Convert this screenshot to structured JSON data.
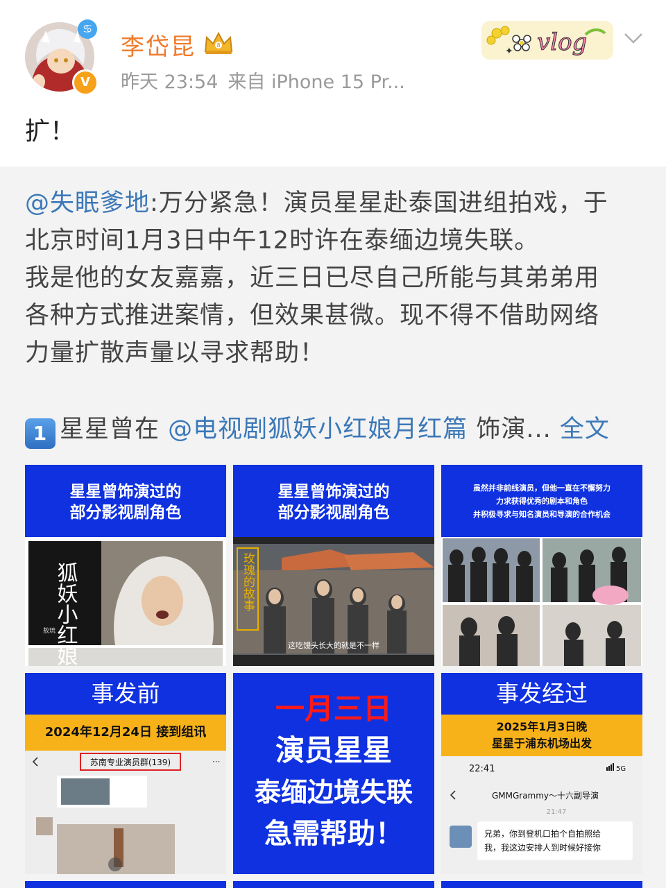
{
  "status_indicator_color": "#ff8a1f",
  "user": {
    "name": "李岱昆",
    "time": "昨天 23:54",
    "source": "来自 iPhone 15 Pr...",
    "verified_icon": "verified-badge-icon",
    "badge_icon": "crown-vip-icon"
  },
  "decor": {
    "vlog_label": "vlog"
  },
  "post": {
    "text": "扩！"
  },
  "repost": {
    "author": "@失眠爹地",
    "line1": ":万分紧急！演员星星赴泰国进组拍戏，于",
    "line2": "北京时间1月3日中午12时许在泰缅边境失联。",
    "line3": "我是他的女友嘉嘉，近三日已尽自己所能与其弟弟用",
    "line4": "各种方式推进案情，但效果甚微。现不得不借助网络",
    "line5": "力量扩散声量以寻求帮助！",
    "item_number": "1",
    "item_prefix": "星星曾在",
    "item_mention": "@电视剧狐妖小红娘月红篇",
    "item_suffix": "饰演...",
    "full_text": "全文"
  },
  "images": {
    "img1": {
      "title_line1": "星星曾饰演过的",
      "title_line2": "部分影视剧角色",
      "poster_text": "狐妖小红娘",
      "poster_small": "敖琉"
    },
    "img2": {
      "title_line1": "星星曾饰演过的",
      "title_line2": "部分影视剧角色",
      "vertical_text": "玫瑰的故事",
      "subtitle": "这吃馒头长大的就是不一样"
    },
    "img3": {
      "line1": "虽然并非前线演员，但他一直在不懈努力",
      "line2": "力求获得优秀的剧本和角色",
      "line3": "并积极寻求与知名演员和导演的合作机会"
    },
    "img4": {
      "title": "事发前",
      "date_line": "2024年12月24日 接到组讯",
      "group_name": "苏南专业演员群(139)"
    },
    "img5": {
      "line1": "一月三日",
      "line2": "演员星星",
      "line3": "泰缅边境失联",
      "line4": "急需帮助！"
    },
    "img6": {
      "title": "事发经过",
      "date_line1": "2025年1月3日晚",
      "date_line2": "星星于浦东机场出发",
      "phone_time": "22:41",
      "signal": "5G",
      "chat_title": "GMMGrammy～十六副导演",
      "chat_time": "21:47",
      "message_line1": "兄弟，你到登机口拍个自拍照给",
      "message_line2": "我，我这边安排人到时候好接你"
    }
  }
}
